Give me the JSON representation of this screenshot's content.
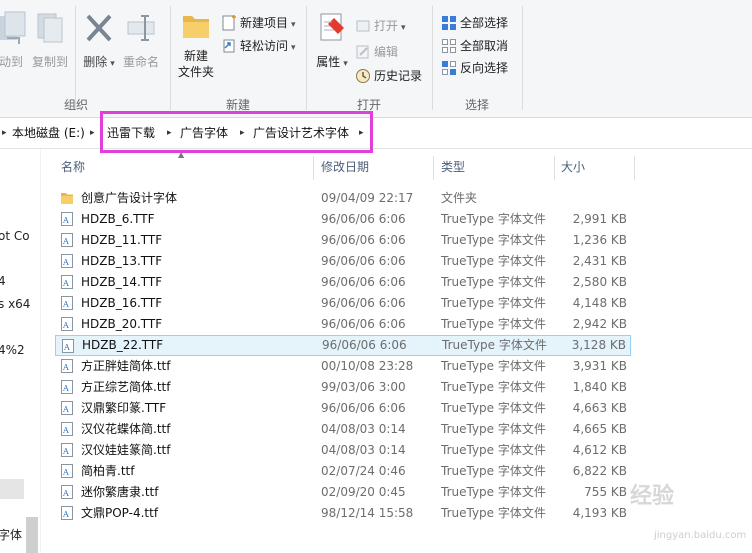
{
  "ribbon": {
    "organize": {
      "group_label": "组织",
      "move_to": "动到",
      "copy_to": "复制到",
      "delete": "删除",
      "rename": "重命名"
    },
    "new": {
      "group_label": "新建",
      "new_folder_line1": "新建",
      "new_folder_line2": "文件夹",
      "new_item": "新建项目",
      "easy_access": "轻松访问"
    },
    "open": {
      "group_label": "打开",
      "properties": "属性",
      "open": "打开",
      "edit": "编辑",
      "history": "历史记录"
    },
    "select": {
      "group_label": "选择",
      "select_all": "全部选择",
      "select_none": "全部取消",
      "invert": "反向选择"
    }
  },
  "address": {
    "items": [
      "本地磁盘 (E:)",
      "迅雷下载",
      "广告字体",
      "广告设计艺术字体"
    ]
  },
  "nav_fragments": [
    "ot Co",
    "4",
    "s x64",
    "4%2",
    "字体"
  ],
  "columns": {
    "name": "名称",
    "date": "修改日期",
    "type": "类型",
    "size": "大小"
  },
  "files": [
    {
      "name": "创意广告设计字体",
      "date": "09/04/09 22:17",
      "type": "文件夹",
      "size": "",
      "kind": "folder"
    },
    {
      "name": "HDZB_6.TTF",
      "date": "96/06/06 6:06",
      "type": "TrueType 字体文件",
      "size": "2,991 KB",
      "kind": "font"
    },
    {
      "name": "HDZB_11.TTF",
      "date": "96/06/06 6:06",
      "type": "TrueType 字体文件",
      "size": "1,236 KB",
      "kind": "font"
    },
    {
      "name": "HDZB_13.TTF",
      "date": "96/06/06 6:06",
      "type": "TrueType 字体文件",
      "size": "2,431 KB",
      "kind": "font"
    },
    {
      "name": "HDZB_14.TTF",
      "date": "96/06/06 6:06",
      "type": "TrueType 字体文件",
      "size": "2,580 KB",
      "kind": "font"
    },
    {
      "name": "HDZB_16.TTF",
      "date": "96/06/06 6:06",
      "type": "TrueType 字体文件",
      "size": "4,148 KB",
      "kind": "font"
    },
    {
      "name": "HDZB_20.TTF",
      "date": "96/06/06 6:06",
      "type": "TrueType 字体文件",
      "size": "2,942 KB",
      "kind": "font"
    },
    {
      "name": "HDZB_22.TTF",
      "date": "96/06/06 6:06",
      "type": "TrueType 字体文件",
      "size": "3,128 KB",
      "kind": "font",
      "selected": true
    },
    {
      "name": "方正胖娃简体.ttf",
      "date": "00/10/08 23:28",
      "type": "TrueType 字体文件",
      "size": "3,931 KB",
      "kind": "font"
    },
    {
      "name": "方正综艺简体.ttf",
      "date": "99/03/06 3:00",
      "type": "TrueType 字体文件",
      "size": "1,840 KB",
      "kind": "font"
    },
    {
      "name": "汉鼎繁印篆.TTF",
      "date": "96/06/06 6:06",
      "type": "TrueType 字体文件",
      "size": "4,663 KB",
      "kind": "font"
    },
    {
      "name": "汉仪花蝶体简.ttf",
      "date": "04/08/03 0:14",
      "type": "TrueType 字体文件",
      "size": "4,665 KB",
      "kind": "font"
    },
    {
      "name": "汉仪娃娃篆简.ttf",
      "date": "04/08/03 0:14",
      "type": "TrueType 字体文件",
      "size": "4,612 KB",
      "kind": "font"
    },
    {
      "name": "简柏青.ttf",
      "date": "02/07/24 0:46",
      "type": "TrueType 字体文件",
      "size": "6,822 KB",
      "kind": "font"
    },
    {
      "name": "迷你繁唐隶.ttf",
      "date": "02/09/20 0:45",
      "type": "TrueType 字体文件",
      "size": "755 KB",
      "kind": "font"
    },
    {
      "name": "文鼎POP-4.ttf",
      "date": "98/12/14 15:58",
      "type": "TrueType 字体文件",
      "size": "4,193 KB",
      "kind": "font"
    }
  ],
  "watermark": {
    "text": "经验",
    "url": "jingyan.baidu.com"
  }
}
